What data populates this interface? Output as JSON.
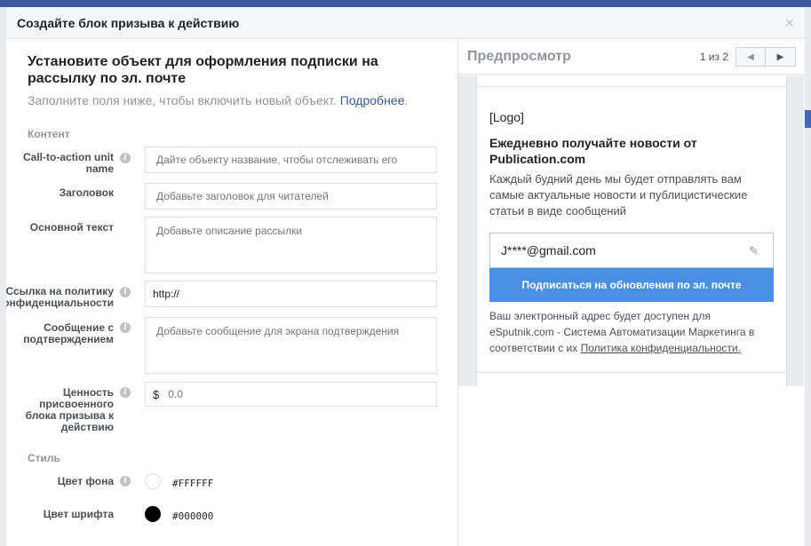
{
  "modal": {
    "title": "Создайте блок призыва к действию",
    "close_symbol": "×"
  },
  "intro": {
    "title": "Установите объект для оформления подписки на рассылку по эл. почте",
    "subtitle": "Заполните поля ниже, чтобы включить новый объект.",
    "link": "Подробнее",
    "link_suffix": "."
  },
  "sections": {
    "content": "Контент",
    "style": "Стиль"
  },
  "fields": {
    "cta_name": {
      "label": "Call-to-action unit name",
      "placeholder": "Дайте объекту название, чтобы отслеживать его"
    },
    "headline": {
      "label": "Заголовок",
      "placeholder": "Добавьте заголовок для читателей"
    },
    "body": {
      "label": "Основной текст",
      "placeholder": "Добавьте описание рассылки"
    },
    "privacy": {
      "label": "Ссылка на политику конфиденциальности",
      "value": "http://"
    },
    "confirm": {
      "label": "Сообщение с подтверждением",
      "placeholder": "Добавьте сообщение для экрана подтверждения"
    },
    "value": {
      "label": "Ценность присвоенного блока призыва к действию",
      "currency": "$",
      "placeholder": "0.0"
    }
  },
  "style": {
    "bg_label": "Цвет фона",
    "bg_value": "#FFFFFF",
    "font_label": "Цвет шрифта",
    "font_value": "#000000"
  },
  "info_icon": "i",
  "preview": {
    "title": "Предпросмотр",
    "pager": "1 из 2",
    "prev_icon": "◀",
    "next_icon": "▶",
    "logo": "[Logo]",
    "headline": "Ежедневно получайте новости от Publication.com",
    "description": "Каждый будний день мы будет отправлять вам самые актуальные новости и публицистические статьи в виде сообщений",
    "email": "J****@gmail.com",
    "pencil_icon": "✎",
    "button": "Подписаться на обновления по эл. почте",
    "legal_text": "Ваш электронный адрес будет доступен для eSputnik.com - Система Автоматизации Маркетинга в соответствии с их",
    "legal_link": "Политика конфиденциальности."
  },
  "colors": {
    "accent": "#4a90e2",
    "link": "#365899",
    "swatch_white": "#FFFFFF",
    "swatch_black": "#000000"
  }
}
